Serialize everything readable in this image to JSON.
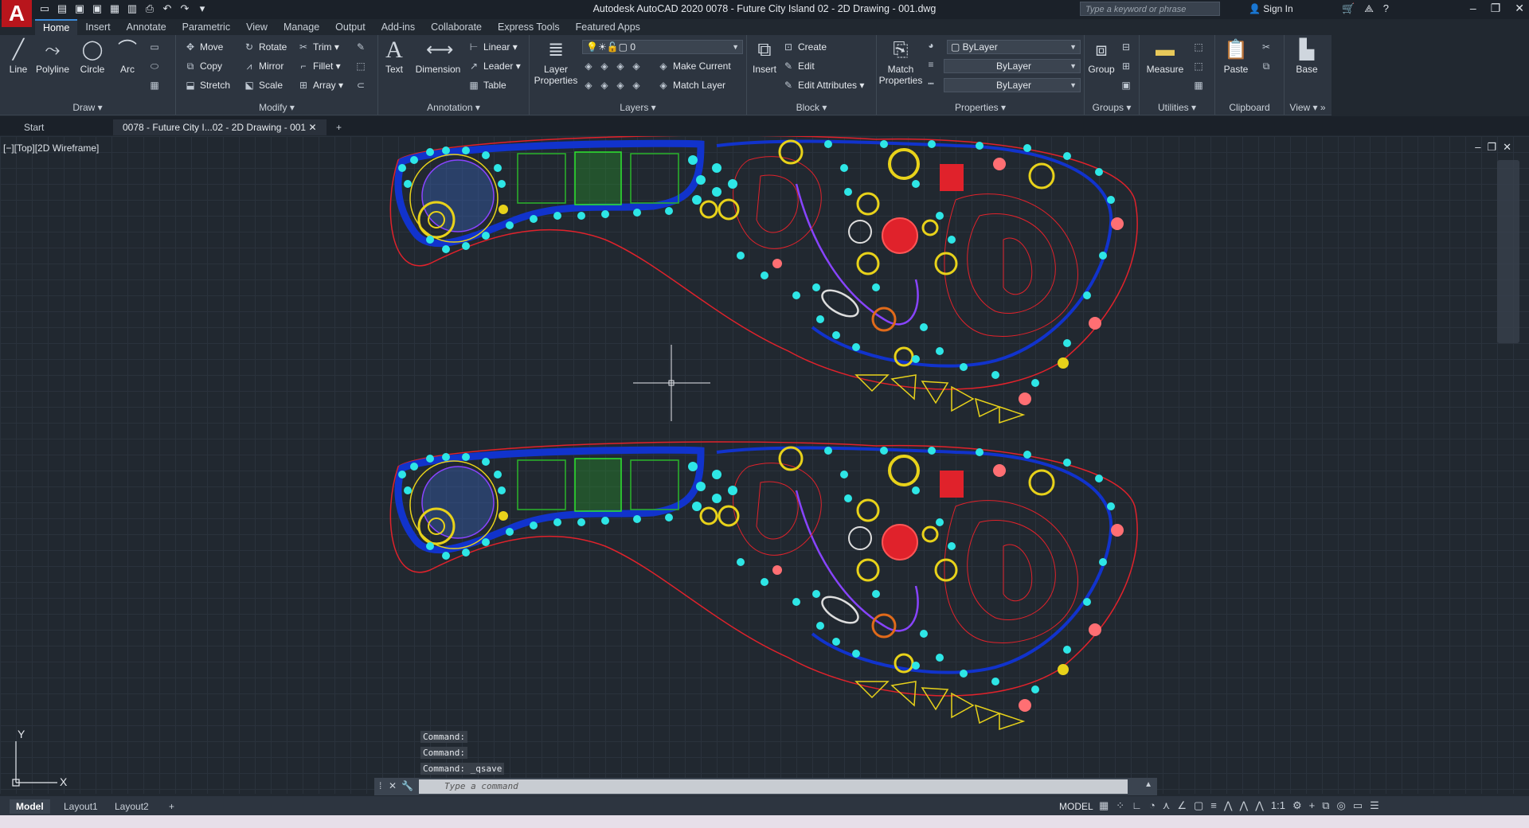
{
  "title": "Autodesk AutoCAD 2020    0078 - Future City Island 02 - 2D Drawing - 001.dwg",
  "search_placeholder": "Type a keyword or phrase",
  "sign_in": "Sign In",
  "menu_tabs": [
    "Home",
    "Insert",
    "Annotate",
    "Parametric",
    "View",
    "Manage",
    "Output",
    "Add-ins",
    "Collaborate",
    "Express Tools",
    "Featured Apps"
  ],
  "ribbon": {
    "draw": {
      "title": "Draw",
      "line": "Line",
      "polyline": "Polyline",
      "circle": "Circle",
      "arc": "Arc"
    },
    "modify": {
      "title": "Modify",
      "move": "Move",
      "rotate": "Rotate",
      "trim": "Trim",
      "copy": "Copy",
      "mirror": "Mirror",
      "fillet": "Fillet",
      "stretch": "Stretch",
      "scale": "Scale",
      "array": "Array"
    },
    "annotation": {
      "title": "Annotation",
      "text": "Text",
      "dimension": "Dimension",
      "linear": "Linear",
      "leader": "Leader",
      "table": "Table"
    },
    "layers": {
      "title": "Layers",
      "layer_properties": "Layer Properties",
      "current_layer": "0",
      "make_current": "Make Current",
      "match_layer": "Match Layer"
    },
    "block": {
      "title": "Block",
      "insert": "Insert",
      "create": "Create",
      "edit": "Edit",
      "edit_attributes": "Edit Attributes"
    },
    "properties": {
      "title": "Properties",
      "match_properties": "Match Properties",
      "color": "ByLayer",
      "linetype": "ByLayer",
      "lineweight": "ByLayer"
    },
    "groups": {
      "title": "Groups",
      "group": "Group"
    },
    "utilities": {
      "title": "Utilities",
      "measure": "Measure"
    },
    "clipboard": {
      "title": "Clipboard",
      "paste": "Paste"
    },
    "view": {
      "title": "View",
      "base": "Base"
    }
  },
  "doc_tabs": {
    "start": "Start",
    "drawing": "0078 - Future City I...02 - 2D Drawing - 001"
  },
  "viewport_label": "[−][Top][2D Wireframe]",
  "command_history": [
    "Command:",
    "Command:",
    "Command: _qsave"
  ],
  "command_placeholder": "Type a command",
  "layout_tabs": [
    "Model",
    "Layout1",
    "Layout2"
  ],
  "status": {
    "model": "MODEL",
    "scale": "1:1"
  },
  "colors": {
    "outline": "#e0222b",
    "path": "#1133cc",
    "shrub": "#2ee6e6",
    "tree": "#e8d21a",
    "accent_red": "#ff2222",
    "purple": "#8844ff",
    "pink": "#ff6f73",
    "app_red": "#b8151c"
  }
}
